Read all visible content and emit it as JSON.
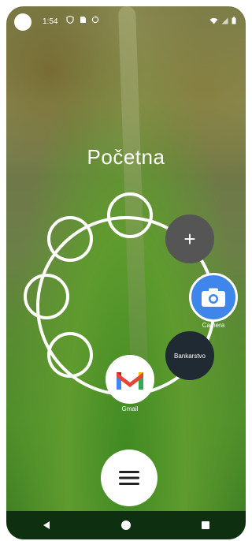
{
  "status_bar": {
    "time": "1:54",
    "icons": [
      "shield-icon",
      "sd-card-icon",
      "sync-icon",
      "wifi-icon",
      "signal-icon",
      "battery-icon"
    ]
  },
  "home": {
    "title": "Početna"
  },
  "apps": {
    "add_label": "+",
    "camera_label": "Camera",
    "bank_label": "Bankarstvo",
    "gmail_label": "Gmail"
  },
  "colors": {
    "camera_blue": "#3f86ea",
    "add_gray": "#555555",
    "bank_dark": "#1f2a32",
    "nav_bar": "#0e2f10"
  },
  "navigation": {
    "buttons": [
      "back-icon",
      "home-icon",
      "recents-icon"
    ]
  }
}
